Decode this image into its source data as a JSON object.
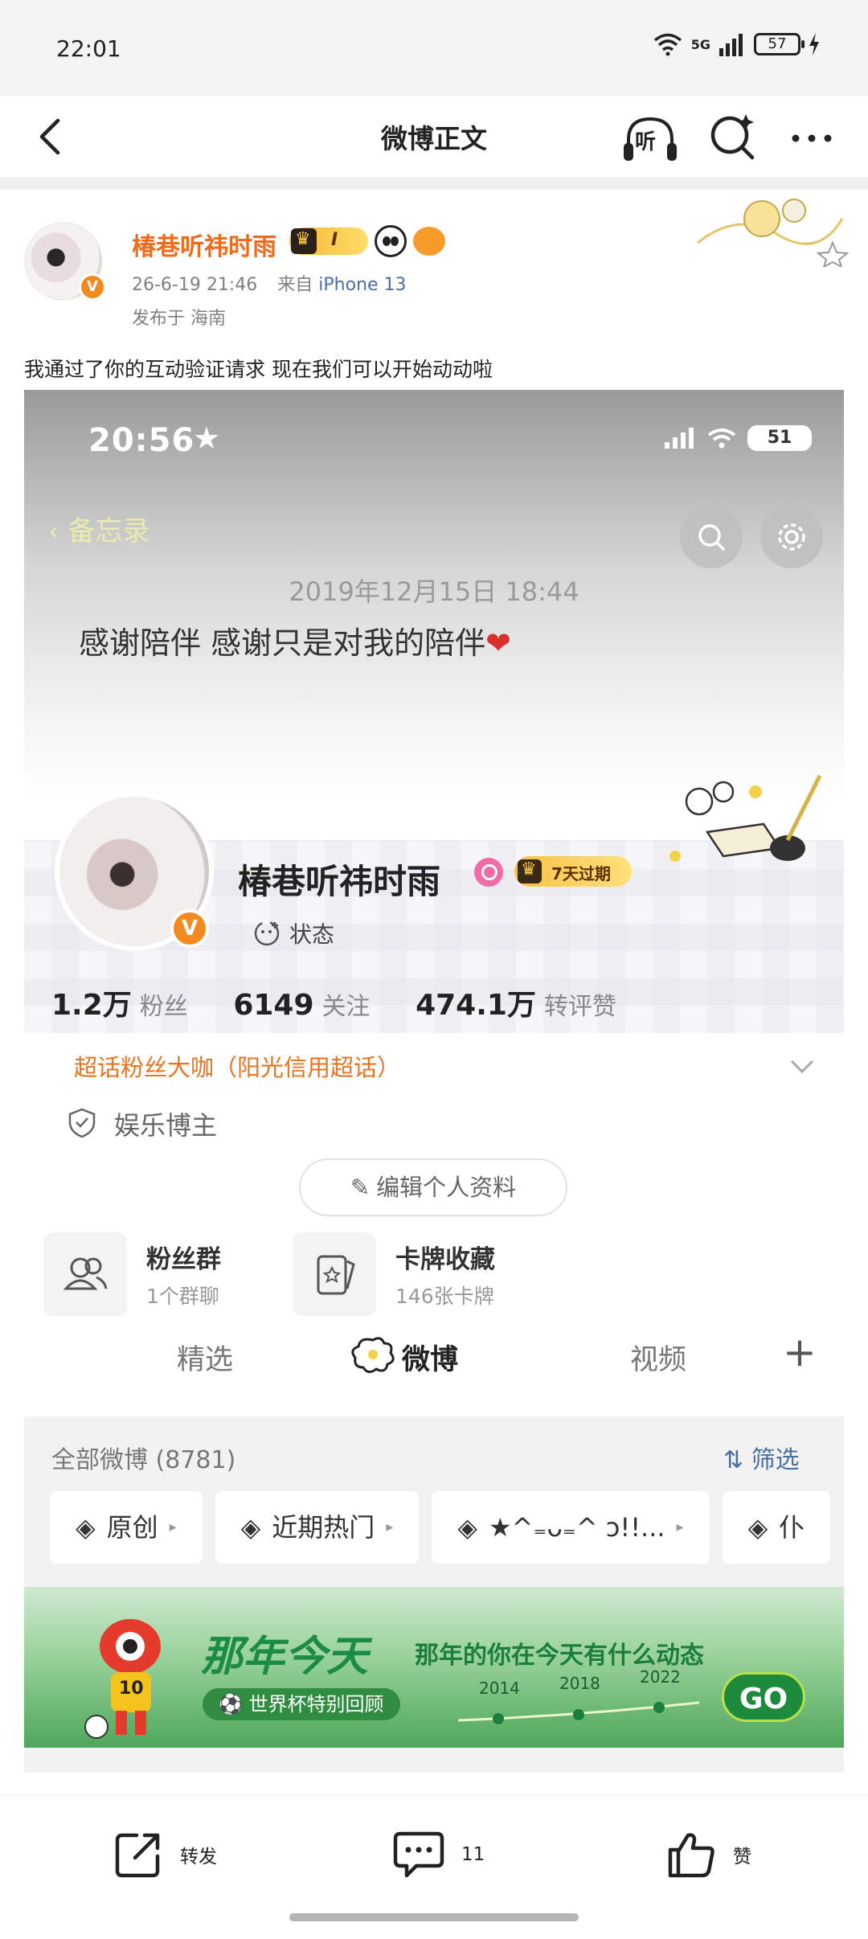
{
  "status_bar": {
    "time": "22:01",
    "network": "5G",
    "battery": "57"
  },
  "nav": {
    "title": "微博正文",
    "listen_label": "听"
  },
  "post": {
    "author": "椿巷听祎时雨",
    "vip_level": "I",
    "date": "26-6-19 21:46",
    "from_label": "来自",
    "device": "iPhone 13",
    "location": "发布于 海南",
    "text": "我通过了你的互动验证请求 现在我们可以开始动动啦"
  },
  "screenshot": {
    "time": "20:56",
    "battery": "51",
    "back_label": "备忘录",
    "memo_date": "2019年12月15日 18:44",
    "memo_text": "感谢陪伴 感谢只是对我的陪伴",
    "profile": {
      "name": "椿巷听祎时雨",
      "vip_label": "7天过期",
      "status_label": "状态",
      "stats": [
        {
          "value": "1.2万",
          "label": "粉丝"
        },
        {
          "value": "6149",
          "label": "关注"
        },
        {
          "value": "474.1万",
          "label": "转评赞"
        }
      ],
      "supertopic": "超话粉丝大咖（阳光信用超话）",
      "category": "娱乐博主",
      "edit_button": "编辑个人资料",
      "cards": [
        {
          "title": "粉丝群",
          "sub": "1个群聊"
        },
        {
          "title": "卡牌收藏",
          "sub": "146张卡牌"
        }
      ],
      "tabs": [
        "精选",
        "微博",
        "视频"
      ],
      "all_posts": "全部微博 (8781)",
      "filter": "筛选",
      "chips": [
        "原创",
        "近期热门",
        "★^₌ᴗ₌^ ɔ!!...",
        "仆"
      ],
      "banner": {
        "title": "那年今天",
        "subtitle": "那年的你在今天有什么动态",
        "tag": "世界杯特别回顾",
        "years": [
          "2014",
          "2018",
          "2022"
        ],
        "go": "GO",
        "mascot_number": "10"
      }
    }
  },
  "bottom_bar": {
    "repost": "转发",
    "comments": "11",
    "like": "赞"
  }
}
